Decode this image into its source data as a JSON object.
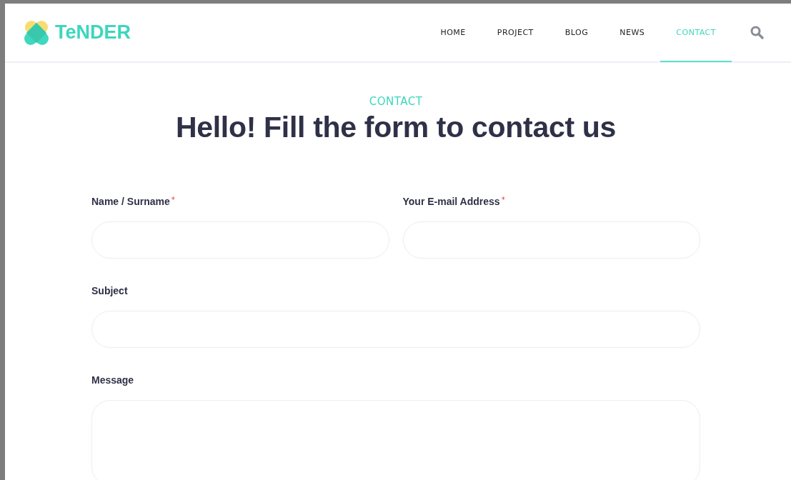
{
  "brand": {
    "name": "TeNDER"
  },
  "nav": [
    {
      "label": "HOME",
      "selected": false
    },
    {
      "label": "PROJECT",
      "selected": false
    },
    {
      "label": "BLOG",
      "selected": false
    },
    {
      "label": "NEWS",
      "selected": false
    },
    {
      "label": "CONTACT",
      "selected": true
    }
  ],
  "eyebrow": "CONTACT",
  "heading": "Hello! Fill the form to contact us",
  "form": {
    "rows": [
      [
        {
          "label": "Name / Surname",
          "required_mark": "*",
          "kind": "input"
        },
        {
          "label": "Your E-mail Address",
          "required_mark": "*",
          "kind": "input"
        }
      ],
      [
        {
          "label": "Subject",
          "kind": "input"
        }
      ],
      [
        {
          "label": "Message",
          "kind": "textarea"
        }
      ]
    ]
  }
}
